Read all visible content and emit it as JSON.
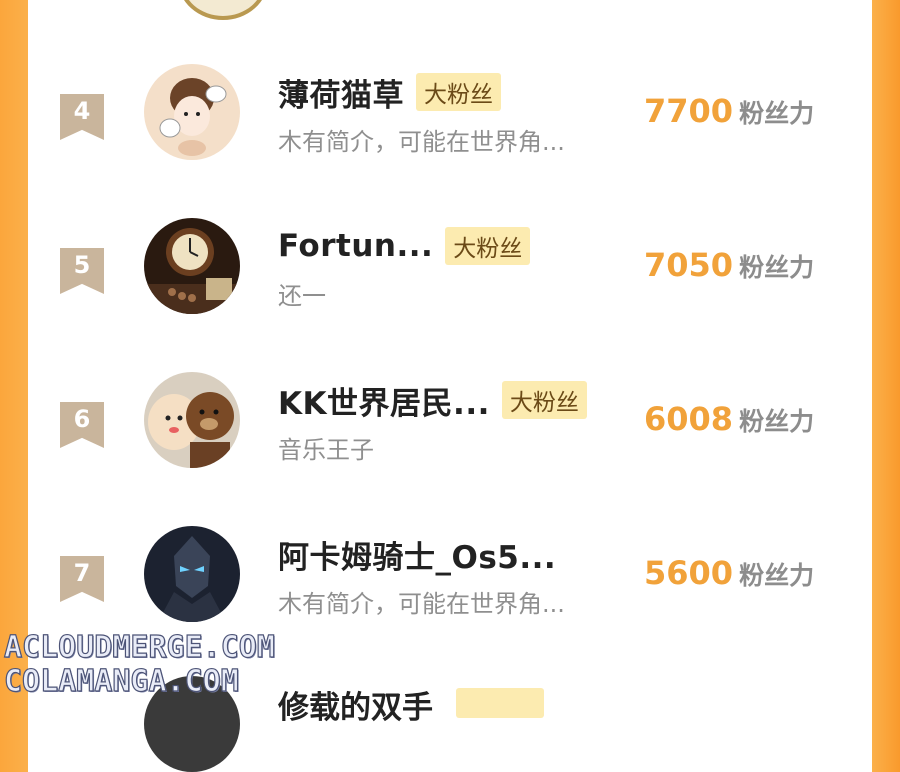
{
  "entries": [
    {
      "rank": "4",
      "name": "薄荷猫草",
      "badge": "大粉丝",
      "desc": "木有简介，可能在世界角...",
      "score": "7700",
      "unit": "粉丝力"
    },
    {
      "rank": "5",
      "name": "Fortun...",
      "badge": "大粉丝",
      "desc": "还一",
      "score": "7050",
      "unit": "粉丝力"
    },
    {
      "rank": "6",
      "name": "KK世界居民...",
      "badge": "大粉丝",
      "desc": "音乐王子",
      "score": "6008",
      "unit": "粉丝力"
    },
    {
      "rank": "7",
      "name": "阿卡姆骑士_Os5...",
      "badge": "",
      "desc": "木有简介，可能在世界角...",
      "score": "5600",
      "unit": "粉丝力"
    }
  ],
  "partial_entry": {
    "name": "修载的双手"
  },
  "watermark": {
    "line1": "ACLOUDMERGE.COM",
    "line2": "COLAMANGA.COM"
  },
  "colors": {
    "accent_orange": "#f1a23a",
    "badge_bg": "#fcebb0",
    "rank_tag": "#c9b59c",
    "frame": "#fbb04a"
  },
  "avatars": [
    "cartoon-girl-avatar",
    "clock-avatar",
    "plush-bears-avatar",
    "armored-knight-avatar"
  ]
}
